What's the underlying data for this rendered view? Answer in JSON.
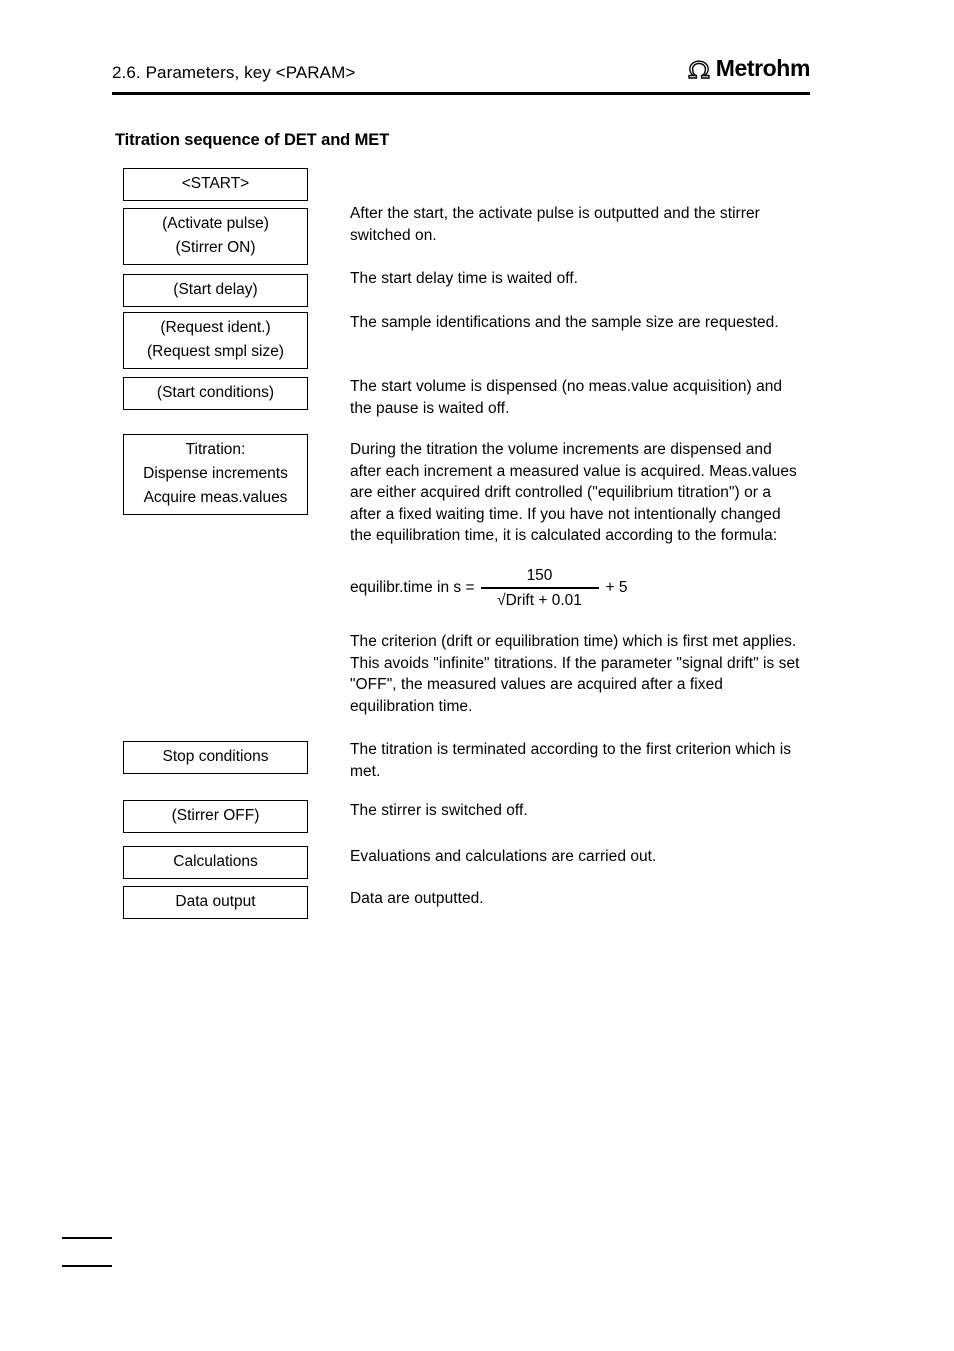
{
  "header": {
    "title": "2.6. Parameters, key <PARAM>",
    "logo_text": "Metrohm",
    "logo_mark": "omega-icon"
  },
  "section": {
    "heading": "Titration sequence of DET and MET"
  },
  "flow": {
    "boxes": [
      {
        "lines": [
          "<START>"
        ]
      },
      {
        "lines": [
          "(Activate pulse)",
          "(Stirrer ON)"
        ]
      },
      {
        "lines": [
          "(Start delay)"
        ]
      },
      {
        "lines": [
          "(Request ident.)",
          "(Request smpl size)"
        ]
      },
      {
        "lines": [
          "(Start conditions)"
        ]
      },
      {
        "lines": [
          "Titration:",
          "Dispense increments",
          "Acquire meas.values"
        ]
      },
      {
        "lines": [
          "Stop conditions"
        ]
      },
      {
        "lines": [
          "(Stirrer OFF)"
        ]
      },
      {
        "lines": [
          "Calculations"
        ]
      },
      {
        "lines": [
          "Data output"
        ]
      }
    ]
  },
  "paragraphs": [
    "After the start, the activate pulse is outputted and the stirrer switched on.",
    "The start delay time is waited off.",
    "The sample identifications and the sample size are requested.",
    "The start volume is dispensed (no meas.value acquisition) and the pause is waited off.",
    "During the titration the volume increments are dispensed and after each increment a measured value is acquired. Meas.values are either acquired drift controlled (\"equilibrium titration\") or a after a fixed waiting time. If you have not intentionally changed the equilibration time, it is calculated according to the formula:",
    "The criterion (drift or equilibration time) which is first met applies. This avoids \"infinite\" titrations. If the parameter \"signal drift\" is set \"OFF\", the measured values are acquired after a fixed equilibration time.",
    "The titration is terminated according to the first criterion which is met.",
    "The stirrer is switched off.",
    "Evaluations and calculations are carried out.",
    "Data are outputted."
  ],
  "formula": {
    "lhs": "equilibr.time in s  =",
    "numerator": "150",
    "denominator": "√Drift + 0.01",
    "rhs": "+ 5"
  }
}
